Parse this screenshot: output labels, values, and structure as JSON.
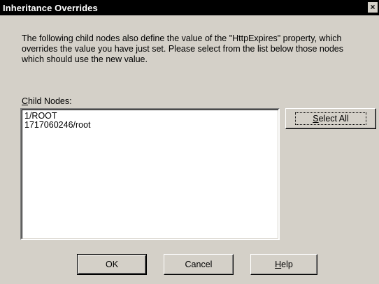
{
  "dialog": {
    "title": "Inheritance Overrides",
    "close_symbol": "×",
    "message_line1": "The following child nodes also define the value of the  \"HttpExpires\" property, which",
    "message_line2": "overrides the value you have just set.  Please select from the list below those nodes",
    "message_line3": "which should use the new value.",
    "child_nodes_label_mnemonic": "C",
    "child_nodes_label_rest": "hild Nodes:",
    "child_nodes": [
      "1/ROOT",
      "1717060246/root"
    ],
    "select_all_mnemonic": "S",
    "select_all_rest": "elect All",
    "ok_label": "OK",
    "cancel_label": "Cancel",
    "help_mnemonic": "H",
    "help_rest": "elp"
  }
}
